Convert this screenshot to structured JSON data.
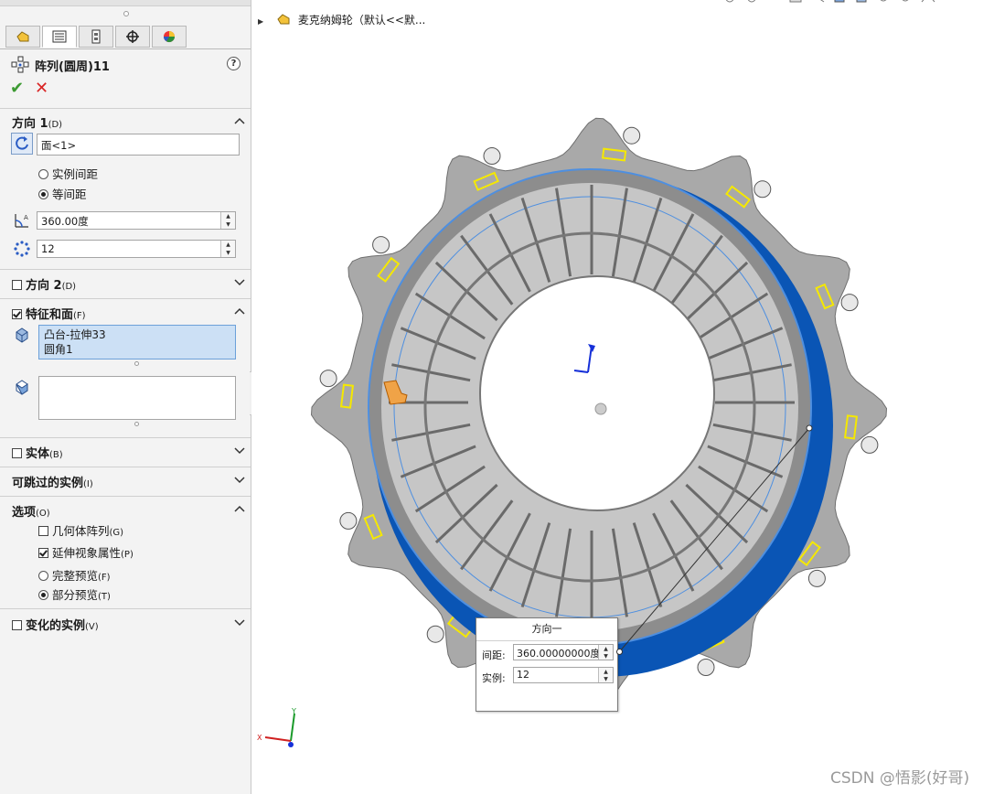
{
  "breadcrumb": {
    "label": "麦克纳姆轮（默认<<默..."
  },
  "feature": {
    "title": "阵列(圆周)11",
    "help": "?"
  },
  "direction1": {
    "title": "方向 1",
    "suffix": "(D)",
    "face_value": "面<1>",
    "radio_instance_spacing": "实例间距",
    "radio_equal_spacing": "等间距",
    "angle_value": "360.00度",
    "count_value": "12"
  },
  "direction2": {
    "title": "方向 2",
    "suffix": "(D)"
  },
  "features_faces": {
    "title": "特征和面",
    "suffix": "(F)",
    "features": [
      "凸台-拉伸33",
      "圆角1"
    ]
  },
  "bodies": {
    "title": "实体",
    "suffix": "(B)"
  },
  "skip_instances": {
    "title": "可跳过的实例",
    "suffix": "(I)"
  },
  "options": {
    "title": "选项",
    "suffix": "(O)",
    "geometry_pattern": "几何体阵列",
    "geometry_pattern_key": "(G)",
    "propagate_visual": "延伸视象属性",
    "propagate_visual_key": "(P)",
    "full_preview": "完整预览",
    "full_preview_key": "(F)",
    "partial_preview": "部分预览",
    "partial_preview_key": "(T)"
  },
  "varying_instances": {
    "title": "变化的实例",
    "suffix": "(V)"
  },
  "hud": {
    "title": "方向一",
    "spacing_label": "间距:",
    "spacing_value": "360.00000000度",
    "instances_label": "实例:",
    "instances_value": "12"
  },
  "triad": {
    "x": "X",
    "y": "Y"
  },
  "watermark": "CSDN @悟影(好哥)",
  "colors": {
    "accent_blue": "#0a55b5",
    "highlight_yellow": "#f5e800",
    "selection": "#cce0f5",
    "ok_green": "#3c9a32",
    "cancel_red": "#d92525"
  }
}
